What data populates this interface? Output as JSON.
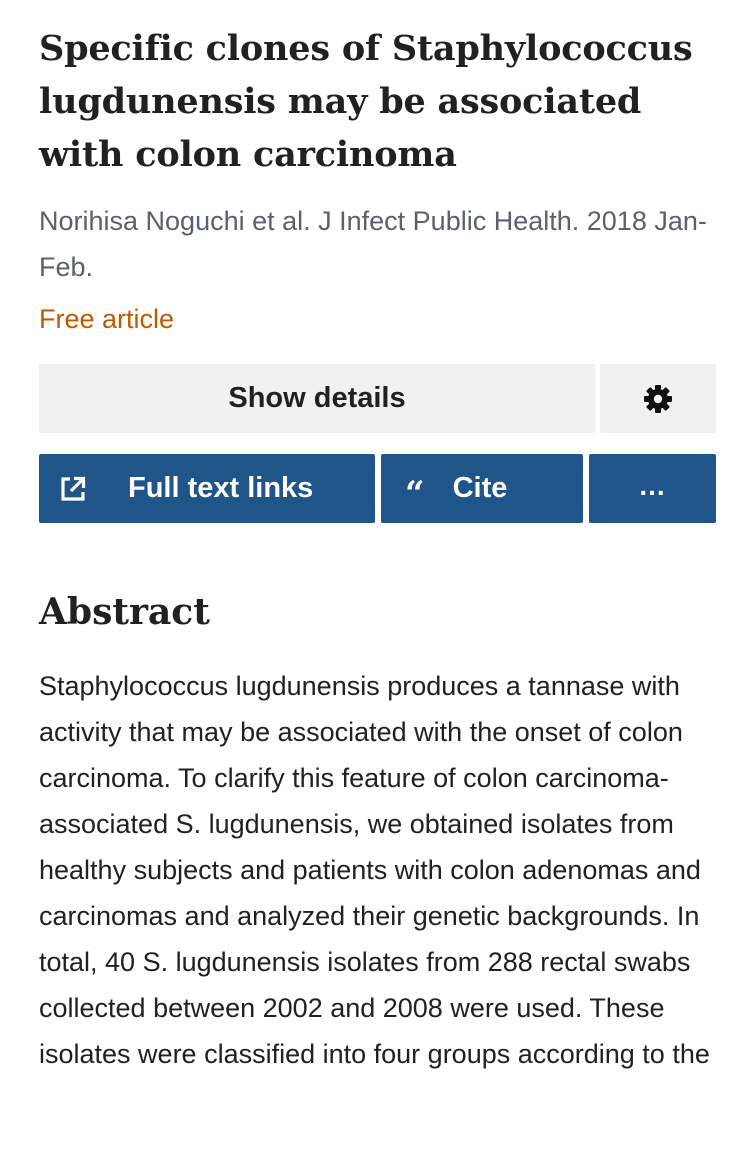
{
  "article": {
    "title": "Specific clones of Staphylococcus lugdunensis may be associated with colon carcinoma",
    "citation": "Norihisa Noguchi et al. J Infect Public Health. 2018 Jan-Feb.",
    "free_label": "Free article"
  },
  "actions": {
    "show_details_label": "Show details",
    "settings_icon": "gear-icon",
    "full_text_label": "Full text links",
    "full_text_icon": "external-link-icon",
    "cite_label": "Cite",
    "cite_icon": "quote-icon",
    "cite_glyph": "“",
    "more_label": "...",
    "more_icon": "more-icon"
  },
  "abstract": {
    "heading": "Abstract",
    "text": "Staphylococcus lugdunensis produces a tannase with activity that may be associated with the onset of colon carcinoma. To clarify this feature of colon carcinoma-associated S. lugdunensis, we obtained isolates from healthy subjects and patients with colon adenomas and carcinomas and analyzed their genetic backgrounds. In total, 40 S. lugdunensis isolates from 288 rectal swabs collected between 2002 and 2008 were used. These isolates were classified into four groups according to the"
  },
  "colors": {
    "primary_button": "#20558a",
    "secondary_button": "#f1f1f1",
    "free_article": "#bd5b00",
    "meta_text": "#5b616b",
    "body_text": "#212121"
  }
}
